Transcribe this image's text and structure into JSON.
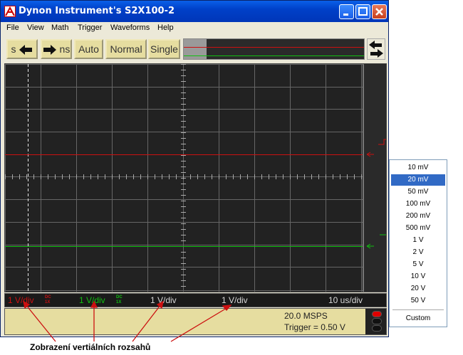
{
  "window": {
    "title": "Dynon Instrument's S2X100-2"
  },
  "menu": [
    "File",
    "View",
    "Math",
    "Trigger",
    "Waveforms",
    "Help"
  ],
  "toolbar": {
    "s_label": "s",
    "ns_label": "ns",
    "auto": "Auto",
    "normal": "Normal",
    "single": "Single"
  },
  "status": {
    "ch1_scale": "1 V/div",
    "ch1_coupling": "DC",
    "ch1_probe": "1X",
    "ch2_scale": "1 V/div",
    "ch2_coupling": "DC",
    "ch2_probe": "1X",
    "ch3_scale": "1 V/div",
    "ch4_scale": "1 V/div",
    "timebase": "10 us/div"
  },
  "info": {
    "sample_rate": "20.0 MSPS",
    "trigger": "Trigger = 0.50 V"
  },
  "range_list": {
    "items": [
      "10 mV",
      "20 mV",
      "50 mV",
      "100 mV",
      "200 mV",
      "500 mV",
      "1 V",
      "2 V",
      "5 V",
      "10 V",
      "20 V",
      "50 V"
    ],
    "selected": "20 mV",
    "custom": "Custom"
  },
  "caption": "Zobrazení vertiálních rozsahů",
  "colors": {
    "ch1": "#cc1010",
    "ch2": "#10c010",
    "ch3": "#d8d8d8",
    "screen_bg": "#222222",
    "grid": "#666666",
    "panel": "#e6dda0",
    "selection": "#316ac5"
  },
  "icons": {
    "app": "dynon-logo-icon",
    "minimize": "minimize-icon",
    "maximize": "maximize-icon",
    "close": "close-icon",
    "left_arrow": "arrow-left-icon",
    "right_arrow": "arrow-right-icon",
    "swap": "swap-arrows-icon",
    "leds": "status-led-icon"
  }
}
